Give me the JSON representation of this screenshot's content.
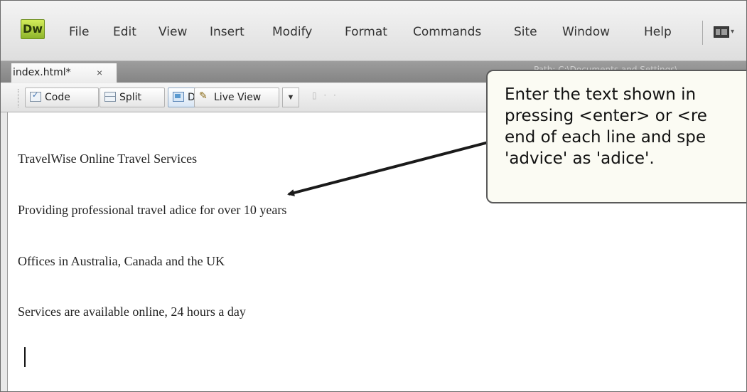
{
  "app": {
    "logo_text": "Dw",
    "menu": [
      "File",
      "Edit",
      "View",
      "Insert",
      "Modify",
      "Format",
      "Commands",
      "Site",
      "Window",
      "Help"
    ]
  },
  "tab": {
    "filename": "index.html*",
    "close_glyph": "×",
    "path": "Path: C:\\Documents and Settings\\"
  },
  "toolbar": {
    "code_label": "Code",
    "split_label": "Split",
    "design_label": "Design",
    "live_view_label": "Live View",
    "dropdown_glyph": "▼"
  },
  "document": {
    "lines": [
      "TravelWise Online Travel Services",
      "Providing professional travel adice for over 10 years",
      "Offices in Australia, Canada and the UK",
      "Services are available online, 24 hours a day"
    ]
  },
  "callout": {
    "text": "Enter the text shown in\npressing <enter> or <re\nend of each line and spe\n'advice' as 'adice'."
  },
  "colors": {
    "logo_green": "#a6cc38",
    "callout_bg": "#fbfbf3",
    "callout_border": "#5a5a5a"
  }
}
